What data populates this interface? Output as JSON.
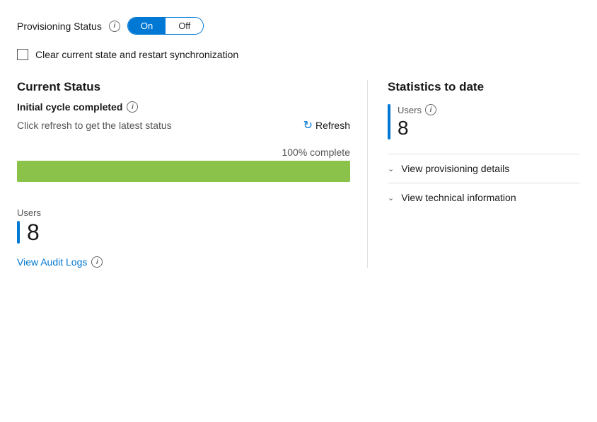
{
  "provisioning": {
    "status_label": "Provisioning Status",
    "toggle_on": "On",
    "toggle_off": "Off",
    "info_icon": "i",
    "checkbox_label": "Clear current state and restart synchronization"
  },
  "current_status": {
    "title": "Current Status",
    "initial_cycle_label": "Initial cycle completed",
    "refresh_hint": "Click refresh to get the latest status",
    "refresh_label": "Refresh",
    "progress_label": "100% complete",
    "progress_percent": 100
  },
  "users_bottom": {
    "label": "Users",
    "count": "8"
  },
  "audit": {
    "link_label": "View Audit Logs"
  },
  "statistics": {
    "title": "Statistics to date",
    "users_label": "Users",
    "users_count": "8"
  },
  "expand_items": [
    {
      "label": "View provisioning details",
      "chevron": "˅"
    },
    {
      "label": "View technical information",
      "chevron": "˅"
    }
  ]
}
